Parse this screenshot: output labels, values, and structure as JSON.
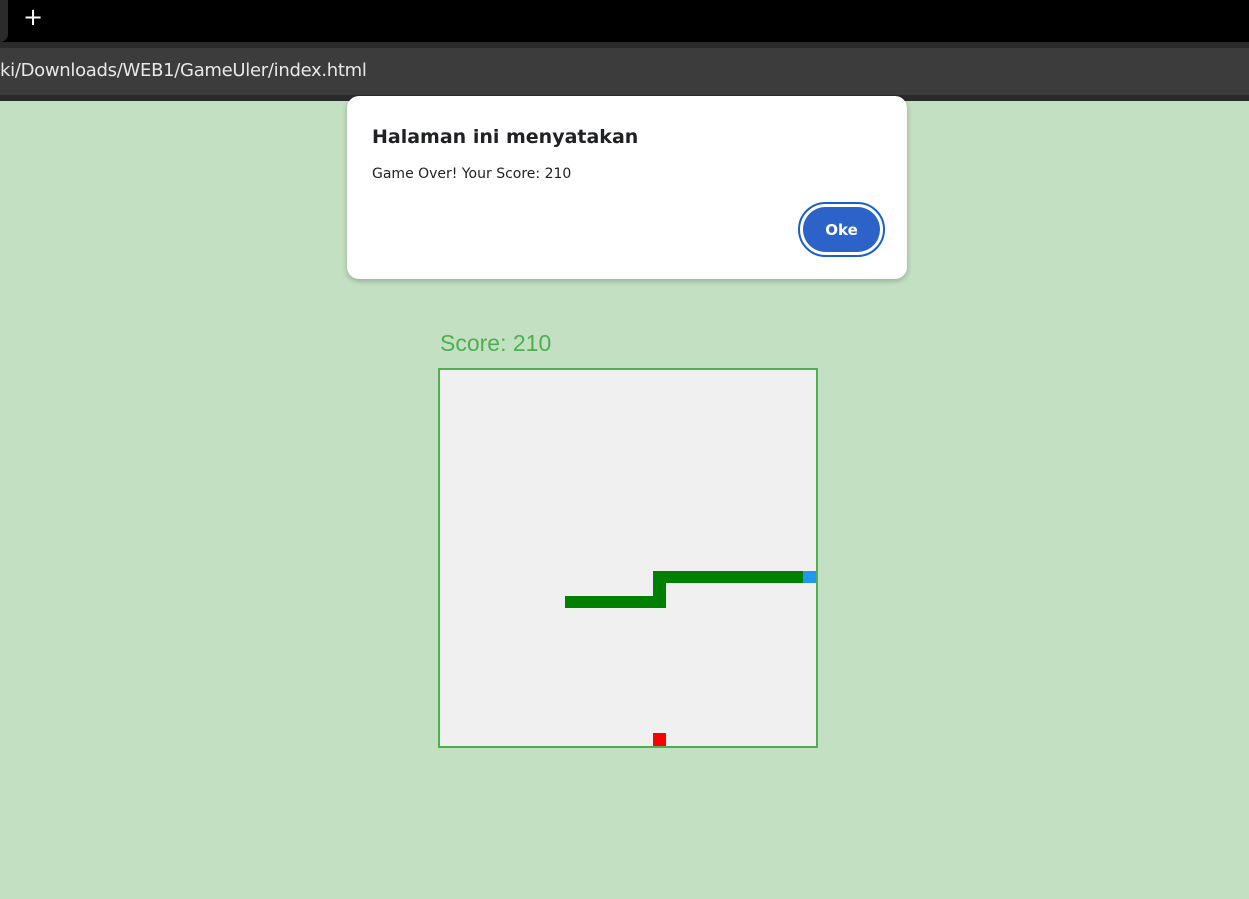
{
  "browser": {
    "new_tab_glyph": "+",
    "url": "ki/Downloads/WEB1/GameUler/index.html"
  },
  "game": {
    "score_text": "Score: 210",
    "grid_cells": 30,
    "snake_color": "#008000",
    "head_color": "#2196f3",
    "food_color": "#ff0000",
    "border_color": "#4caf50",
    "board_bg": "#f0f0f0",
    "snake_path": [
      [
        10,
        18
      ],
      [
        17,
        18
      ],
      [
        17,
        16
      ],
      [
        29,
        16
      ]
    ],
    "head": [
      29,
      16
    ],
    "food": [
      17,
      29
    ]
  },
  "dialog": {
    "title": "Halaman ini menyatakan",
    "message": "Game Over! Your Score: 210",
    "ok_label": "Oke",
    "accent": "#2b63c9"
  }
}
